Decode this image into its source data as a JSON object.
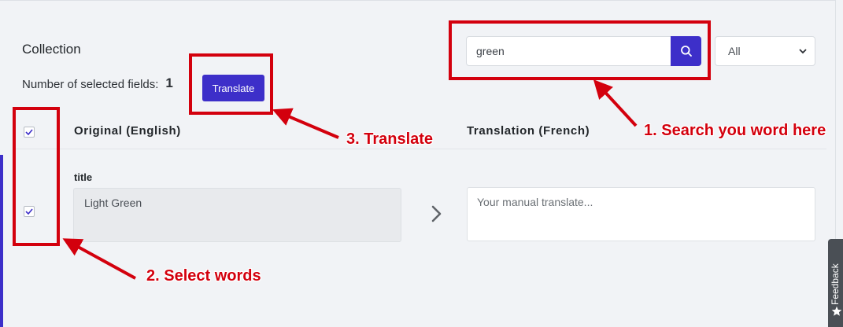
{
  "collection_title": "Collection",
  "selection": {
    "label": "Number of selected fields:",
    "count": "1"
  },
  "translate_button": "Translate",
  "search": {
    "value": "green"
  },
  "filter": {
    "selected": "All"
  },
  "table": {
    "col_original": "Original (English)",
    "col_translation": "Translation (French)",
    "rows": [
      {
        "field": "title",
        "original": "Light Green",
        "translation_placeholder": "Your manual translate..."
      }
    ]
  },
  "annotations": {
    "step1": "1. Search you word here",
    "step2": "2. Select words",
    "step3": "3. Translate"
  },
  "feedback_tab": "Feedback",
  "colors": {
    "accent": "#3d2fc9",
    "annotation": "#d3000d",
    "background": "#f1f3f6"
  },
  "icons": {
    "search": "search-icon",
    "chevron": "chevron-right-icon",
    "select_caret": "chevron-down-icon",
    "feedback": "star-icon"
  }
}
